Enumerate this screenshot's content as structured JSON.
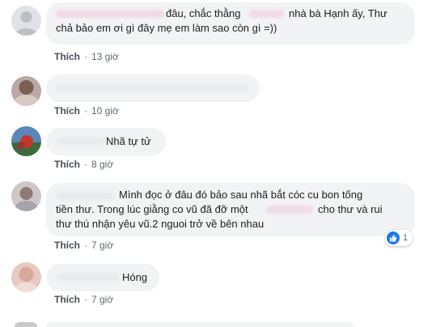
{
  "colors": {
    "bubble": "#f2f3f5",
    "text": "#1c1e21",
    "meta": "#606770",
    "like_blue": "#1877f2"
  },
  "comments": [
    {
      "lines": [
        "đâu, chắc thằng",
        "nhà bà Hạnh ấy, Thư",
        "chả bảo em ơi gì đây mẹ em làm sao còn gì =))"
      ],
      "like_label": "Thích",
      "time": "13 giờ"
    },
    {
      "lines": [],
      "like_label": "Thích",
      "time": "10 giờ"
    },
    {
      "lines": [
        "Nhã tự tử"
      ],
      "like_label": "Thích",
      "time": "8 giờ"
    },
    {
      "lines": [
        "Mình đọc ở đâu đó bảo sau nhã bắt cóc cu bon tống",
        "tiền thư. Trong lúc giằng co vũ đã đỡ một",
        "cho thư và rui",
        "thư thú nhận yêu vũ.2 nguoi trở về bên nhau"
      ],
      "like_label": "Thích",
      "time": "7 giờ",
      "reaction_count": "1",
      "reaction_icon": "thumbs-up-icon"
    },
    {
      "lines": [
        "Hóng"
      ],
      "like_label": "Thích",
      "time": "7 giờ"
    }
  ]
}
